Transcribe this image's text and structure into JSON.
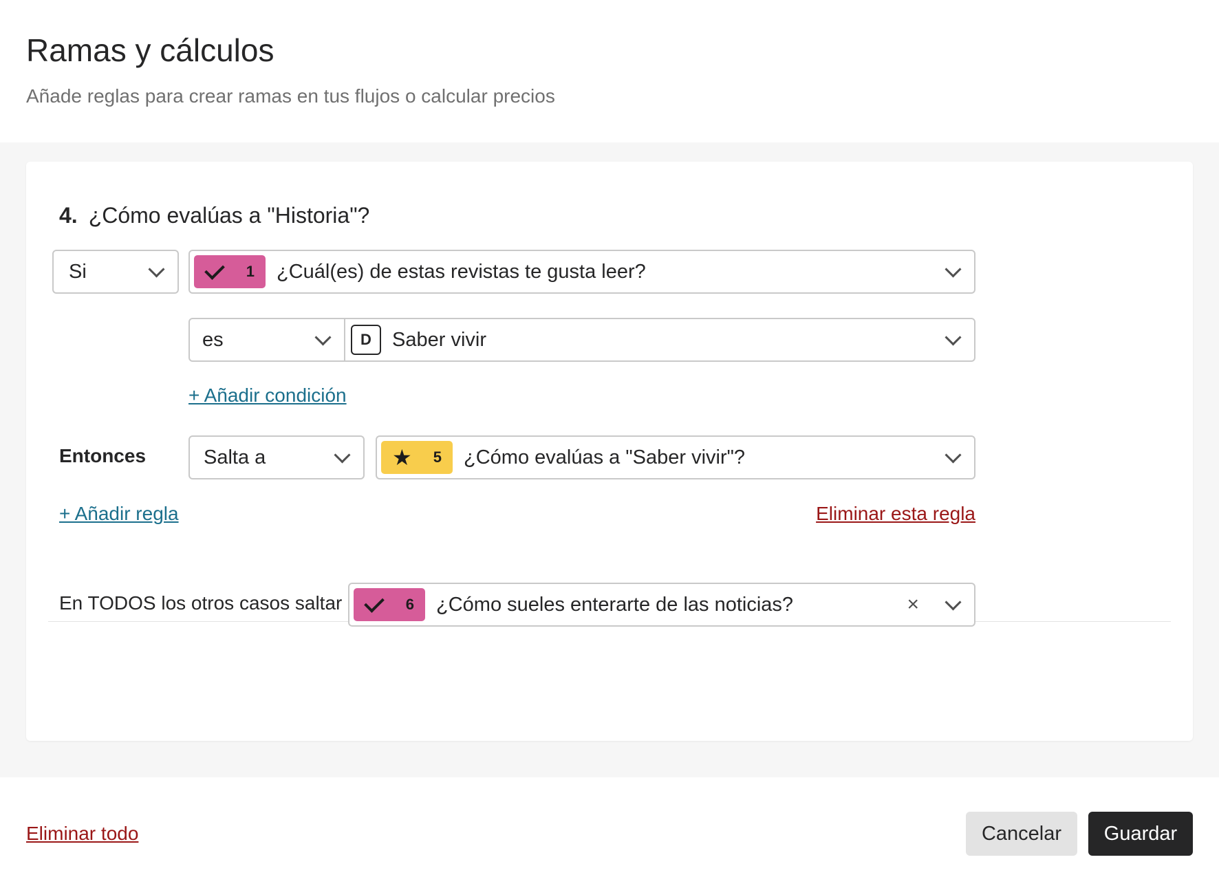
{
  "header": {
    "title": "Ramas y cálculos",
    "subtitle": "Añade reglas para crear ramas en tus flujos o calcular precios"
  },
  "question": {
    "number": "4.",
    "text": "¿Cómo evalúas a \"Historia\"?"
  },
  "rule": {
    "condition_prefix": "Si",
    "condition_question": {
      "icon": "check-icon",
      "number": "1",
      "text": "¿Cuál(es) de estas revistas te gusta leer?",
      "color": "#d65c99"
    },
    "operator": "es",
    "value": {
      "letter": "D",
      "text": "Saber vivir"
    },
    "add_condition_label": "+ Añadir condición",
    "then_label": "Entonces",
    "action": "Salta a",
    "target_question": {
      "icon": "star-icon",
      "number": "5",
      "text": "¿Cómo evalúas a \"Saber vivir\"?",
      "color": "#f8cd4c"
    },
    "add_rule_label": "+ Añadir regla",
    "delete_rule_label": "Eliminar esta regla"
  },
  "fallback": {
    "label": "En TODOS los otros casos saltar a",
    "question": {
      "icon": "check-icon",
      "number": "6",
      "text": "¿Cómo sueles enterarte de las noticias?",
      "color": "#d65c99"
    }
  },
  "footer": {
    "delete_all_label": "Eliminar todo",
    "cancel_label": "Cancelar",
    "save_label": "Guardar"
  }
}
